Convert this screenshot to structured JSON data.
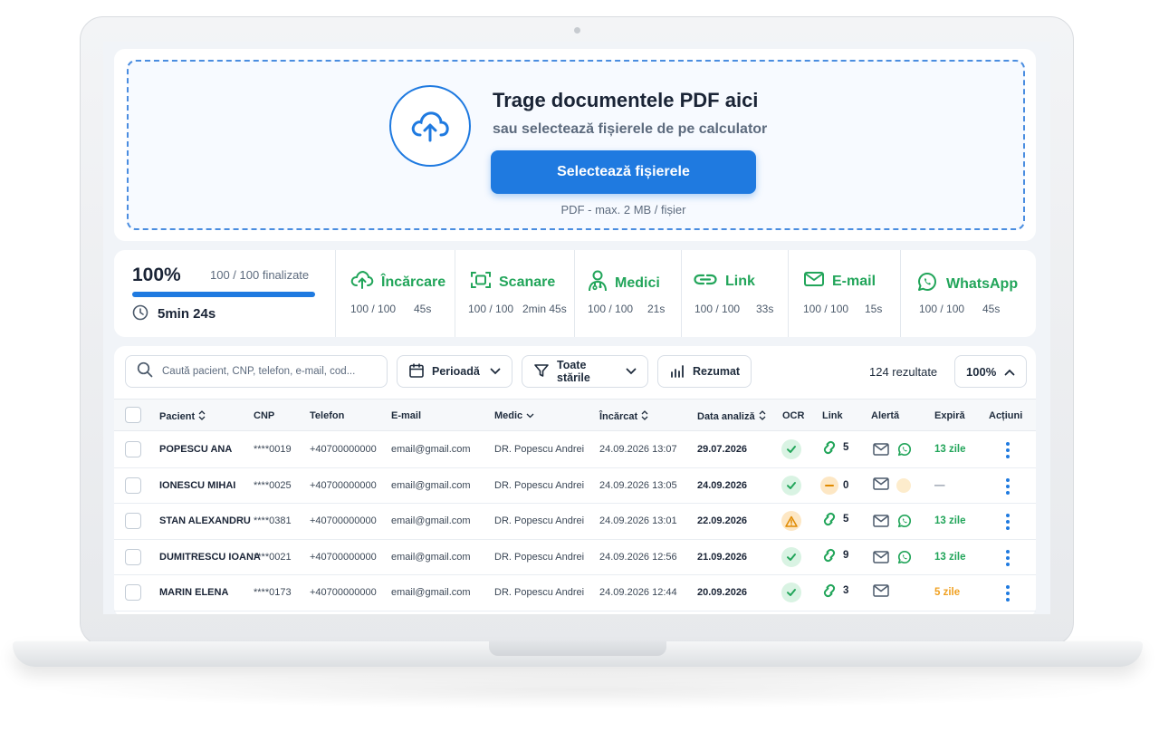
{
  "upload": {
    "title": "Trage documentele PDF aici",
    "subtitle": "sau selectează fișierele de pe calculator",
    "button_label": "Selectează fișierele",
    "note": "PDF - max. 2 MB / fișier",
    "icon": "cloud-upload-icon"
  },
  "progress": {
    "percent_label": "100%",
    "percent_value": 1.0,
    "done_label": "100 / 100 finalizate",
    "elapsed": "5min 24s"
  },
  "stages": [
    {
      "name": "Încărcare",
      "count": "100 / 100",
      "time": "45s",
      "icon": "upload-icon"
    },
    {
      "name": "Scanare",
      "count": "100 / 100",
      "time": "2min 45s",
      "icon": "scan-icon"
    },
    {
      "name": "Medici",
      "count": "100 / 100",
      "time": "21s",
      "icon": "doctor-icon"
    },
    {
      "name": "Link",
      "count": "100 / 100",
      "time": "33s",
      "icon": "link-icon"
    },
    {
      "name": "E-mail",
      "count": "100 / 100",
      "time": "15s",
      "icon": "mail-icon"
    },
    {
      "name": "WhatsApp",
      "count": "100 / 100",
      "time": "45s",
      "icon": "whatsapp-icon"
    }
  ],
  "toolbar": {
    "search_placeholder": "Caută pacient, CNP, telefon, e-mail, cod...",
    "period_label": "Perioadă",
    "status_label": "Toate stările",
    "summary_label": "Rezumat",
    "results": "124 rezultate",
    "zoom": "100%"
  },
  "columns": {
    "patient": "Pacient",
    "cnp": "CNP",
    "phone": "Telefon",
    "email": "E-mail",
    "doctor": "Medic",
    "uploaded": "Încărcat",
    "analysis_date": "Data analiză",
    "ocr": "OCR",
    "link": "Link",
    "alert": "Alertă",
    "expires": "Expiră",
    "actions": "Acțiuni"
  },
  "rows": [
    {
      "patient": "POPESCU ANA",
      "cnp": "****0019",
      "phone": "+40700000000",
      "email": "email@gmail.com",
      "doctor": "DR. Popescu Andrei",
      "uploaded": "24.09.2026 13:07",
      "analysis_date": "29.07.2026",
      "ocr": "ok",
      "link_status": "active",
      "link_count": "5",
      "alerts": [
        "email",
        "whatsapp"
      ],
      "expires": "13 zile",
      "expires_color": "#22a55a"
    },
    {
      "patient": "IONESCU MIHAI",
      "cnp": "****0025",
      "phone": "+40700000000",
      "email": "email@gmail.com",
      "doctor": "DR. Popescu Andrei",
      "uploaded": "24.09.2026 13:05",
      "analysis_date": "24.09.2026",
      "ocr": "ok",
      "link_status": "none",
      "link_count": "0",
      "alerts": [
        "email",
        "pending"
      ],
      "expires": "—",
      "expires_color": "#8a94a3"
    },
    {
      "patient": "STAN ALEXANDRU",
      "cnp": "****0381",
      "phone": "+40700000000",
      "email": "email@gmail.com",
      "doctor": "DR. Popescu Andrei",
      "uploaded": "24.09.2026 13:01",
      "analysis_date": "22.09.2026",
      "ocr": "warn",
      "link_status": "active",
      "link_count": "5",
      "alerts": [
        "email",
        "whatsapp"
      ],
      "expires": "13 zile",
      "expires_color": "#22a55a"
    },
    {
      "patient": "DUMITRESCU IOANA",
      "cnp": "****0021",
      "phone": "+40700000000",
      "email": "email@gmail.com",
      "doctor": "DR. Popescu Andrei",
      "uploaded": "24.09.2026 12:56",
      "analysis_date": "21.09.2026",
      "ocr": "ok",
      "link_status": "active",
      "link_count": "9",
      "alerts": [
        "email",
        "whatsapp"
      ],
      "expires": "13 zile",
      "expires_color": "#22a55a"
    },
    {
      "patient": "MARIN ELENA",
      "cnp": "****0173",
      "phone": "+40700000000",
      "email": "email@gmail.com",
      "doctor": "DR. Popescu Andrei",
      "uploaded": "24.09.2026 12:44",
      "analysis_date": "20.09.2026",
      "ocr": "ok",
      "link_status": "active",
      "link_count": "3",
      "alerts": [
        "email"
      ],
      "expires": "5 zile",
      "expires_color": "#f0a020"
    }
  ],
  "colors": {
    "accent": "#1f7ae0",
    "success": "#22a55a",
    "warning": "#f0a020"
  }
}
